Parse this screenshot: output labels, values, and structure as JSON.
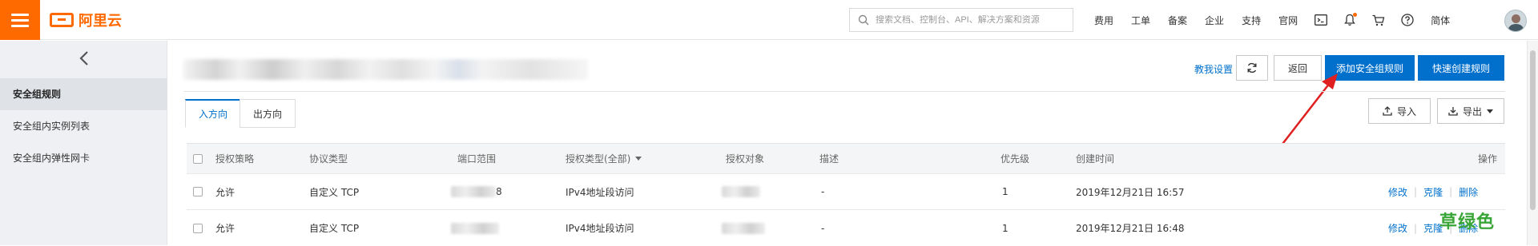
{
  "topbar": {
    "logo_text": "阿里云",
    "search_placeholder": "搜索文档、控制台、API、解决方案和资源",
    "nav": [
      "费用",
      "工单",
      "备案",
      "企业",
      "支持",
      "官网"
    ],
    "lang": "简体",
    "icons": [
      "terminal-icon",
      "bell-icon",
      "cart-icon",
      "help-icon"
    ]
  },
  "sidebar": {
    "items": [
      {
        "label": "安全组规则",
        "active": true
      },
      {
        "label": "安全组内实例列表",
        "active": false
      },
      {
        "label": "安全组内弹性网卡",
        "active": false
      }
    ]
  },
  "header": {
    "teach_link": "教我设置",
    "back_label": "返回",
    "add_rule_label": "添加安全组规则",
    "quick_create_label": "快速创建规则",
    "import_label": "导入",
    "export_label": "导出"
  },
  "tabs": [
    {
      "label": "入方向",
      "active": true
    },
    {
      "label": "出方向",
      "active": false
    }
  ],
  "table": {
    "columns": [
      "授权策略",
      "协议类型",
      "端口范围",
      "授权类型(全部)",
      "授权对象",
      "描述",
      "优先级",
      "创建时间",
      "操作"
    ],
    "rows": [
      {
        "policy": "允许",
        "protocol": "自定义 TCP",
        "port_suffix": "8",
        "auth_type": "IPv4地址段访问",
        "desc": "-",
        "priority": "1",
        "created": "2019年12月21日 16:57"
      },
      {
        "policy": "允许",
        "protocol": "自定义 TCP",
        "port_suffix": "",
        "auth_type": "IPv4地址段访问",
        "desc": "-",
        "priority": "1",
        "created": "2019年12月21日 16:48"
      }
    ],
    "actions": {
      "edit": "修改",
      "clone": "克隆",
      "delete": "删除"
    }
  },
  "watermark": "草绿色",
  "colors": {
    "brand": "#ff6a00",
    "primary": "#0070cc",
    "annotation_arrow": "#e02020"
  }
}
